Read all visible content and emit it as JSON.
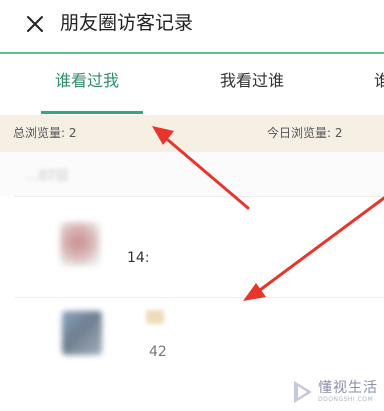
{
  "header": {
    "close_icon": "close-icon",
    "title": "朋友圈访客记录"
  },
  "tabs": [
    {
      "label": "谁看过我",
      "active": true
    },
    {
      "label": "我看过谁",
      "active": false
    },
    {
      "label": "谁",
      "active": false
    }
  ],
  "stats": {
    "total_views": "总浏览量: 2",
    "today_views": "今日浏览量: 2"
  },
  "list": {
    "date_label": "…07日",
    "visitors": [
      {
        "time": "14:",
        "avatar": "blurred-avatar"
      },
      {
        "time": "42",
        "avatar": "blurred-avatar"
      }
    ]
  },
  "watermark": {
    "brand": "懂视生活",
    "sub": "DDONGSHI.COM"
  },
  "colors": {
    "accent": "#35a77a",
    "stats_background": "#f5efe4",
    "arrow": "#e8352b"
  }
}
